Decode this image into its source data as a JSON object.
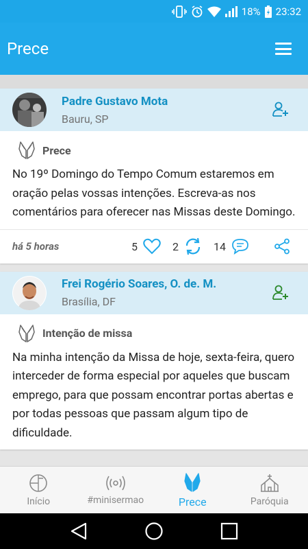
{
  "status_bar": {
    "battery": "18%",
    "time": "23:32"
  },
  "app_bar": {
    "title": "Prece"
  },
  "posts": [
    {
      "author": "Padre Gustavo Mota",
      "location": "Bauru, SP",
      "type": "Prece",
      "text": "No 19º Domingo do Tempo Comum estaremos em oração pelas vossas intenções. Escreva-as nos comentários para oferecer nas Missas deste Domingo.",
      "time": "há 5 horas",
      "likes": "5",
      "shares": "2",
      "comments": "14"
    },
    {
      "author": "Frei Rogério Soares, O. de. M.",
      "location": "Brasília, DF",
      "type": "Intenção de missa",
      "text": "Na minha intenção da Missa de hoje, sexta-feira, quero interceder de forma especial por aqueles que buscam emprego, para que possam encontrar portas abertas e por todas pessoas que passam algum tipo de dificuldade."
    }
  ],
  "bottom_nav": {
    "items": [
      "Início",
      "#minisermao",
      "Prece",
      "Paróquia"
    ],
    "active": "Prece"
  },
  "colors": {
    "primary": "#21a9ea",
    "name": "#1390c3",
    "header_bg": "#d8edf7"
  }
}
